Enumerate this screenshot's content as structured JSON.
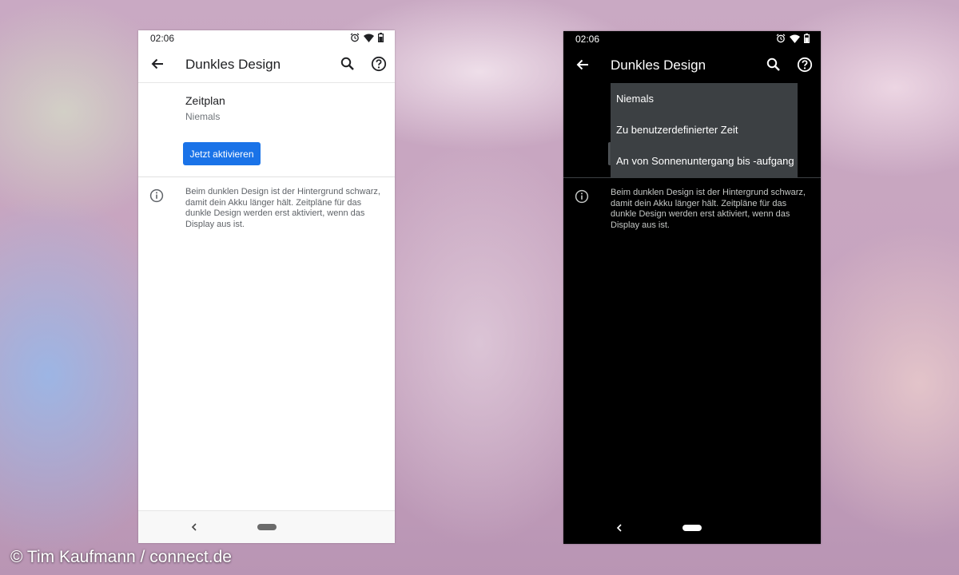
{
  "colors": {
    "accent": "#1a73e8",
    "light_bg": "#ffffff",
    "dark_bg": "#000000",
    "dropdown_bg": "#3c4043"
  },
  "light_screen": {
    "status_time": "02:06",
    "status_icons": [
      "alarm-icon",
      "wifi-icon",
      "battery-icon"
    ],
    "title": "Dunkles Design",
    "toolbar_icons": [
      "back-arrow-icon",
      "search-icon",
      "help-icon"
    ],
    "schedule": {
      "title": "Zeitplan",
      "summary": "Niemals"
    },
    "activate_button": "Jetzt aktivieren",
    "info_text": "Beim dunklen Design ist der Hintergrund schwarz, damit dein Akku länger hält. Zeitpläne für das dunkle Design werden erst aktiviert, wenn das Display aus ist."
  },
  "dark_screen": {
    "status_time": "02:06",
    "status_icons": [
      "alarm-icon",
      "wifi-icon",
      "battery-icon"
    ],
    "title": "Dunkles Design",
    "toolbar_icons": [
      "back-arrow-icon",
      "search-icon",
      "help-icon"
    ],
    "dropdown_options": [
      "Niemals",
      "Zu benutzerdefinierter Zeit",
      "An von Sonnenuntergang bis -aufgang"
    ],
    "info_text": "Beim dunklen Design ist der Hintergrund schwarz, damit dein Akku länger hält. Zeitpläne für das dunkle Design werden erst aktiviert, wenn das Display aus ist."
  },
  "credit": "© Tim Kaufmann / connect.de"
}
